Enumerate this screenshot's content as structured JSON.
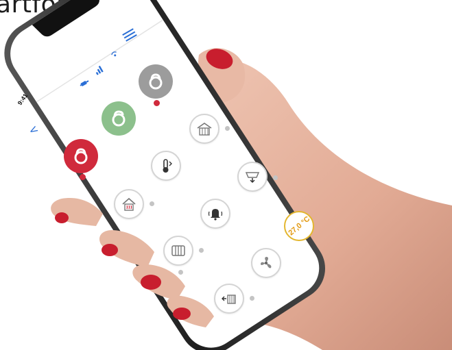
{
  "headline": "artfon.",
  "phone": {
    "status_time": "9:41",
    "temperature": "27,0 °C",
    "accent_color": "#2b6fd6",
    "lock_colors": {
      "locked_red": "#d02a3c",
      "unlocked_green": "#8cc08c",
      "neutral_gray": "#9c9c9c"
    }
  },
  "icons": [
    "back-arrow-icon",
    "menu-icon",
    "power-plug-icon",
    "signal-bars-icon",
    "wireless-icon",
    "padlock-icon",
    "gate-icon",
    "thermometer-icon",
    "awning-icon",
    "house-heating-icon",
    "alarm-bell-icon",
    "radiator-icon",
    "fan-icon",
    "sliding-gate-icon"
  ]
}
